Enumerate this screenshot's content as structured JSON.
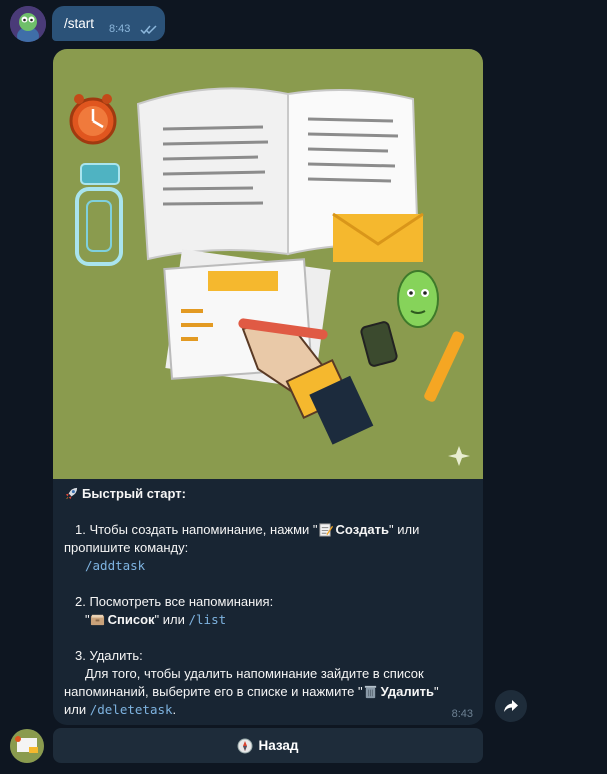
{
  "outgoing": {
    "text": "/start",
    "time": "8:43",
    "ticks_icon": "double-check-icon"
  },
  "bot_message": {
    "image_icon": "notebook-illustration",
    "title": "Быстрый старт:",
    "title_icon": "rocket-icon",
    "step1_lead": "1. Чтобы создать напоминание, нажми \"",
    "step1_icon": "memo-icon",
    "step1_button": "Создать",
    "step1_tail": "\" или",
    "step1_line2": "пропишите команду:",
    "step1_command": "/addtask",
    "step2_title": "2. Посмотреть все напоминания:",
    "step2_quote_open": "\"",
    "step2_icon": "card-index-icon",
    "step2_button": "Список",
    "step2_mid": "\" или ",
    "step2_command": "/list",
    "step3_title": "3. Удалить:",
    "step3_line1": "Для того, чтобы удалить напоминание зайдите в список",
    "step3_line2_lead": "напоминаний, выберите его в списке и нажмите \"",
    "step3_icon": "wastebasket-icon",
    "step3_button": "Удалить",
    "step3_tail": "\"",
    "step3_line3_lead": "или ",
    "step3_command": "/deletetask",
    "step3_end": ".",
    "time": "8:43"
  },
  "keyboard": {
    "back_label": "Назад",
    "back_icon": "compass-icon"
  },
  "share_icon": "share-arrow-icon",
  "colors": {
    "background": "#0e1621",
    "outgoing_bubble": "#2b5278",
    "incoming_bubble": "#182533",
    "command": "#7eb3e0",
    "illustration_bg": "#8a9b4e"
  }
}
